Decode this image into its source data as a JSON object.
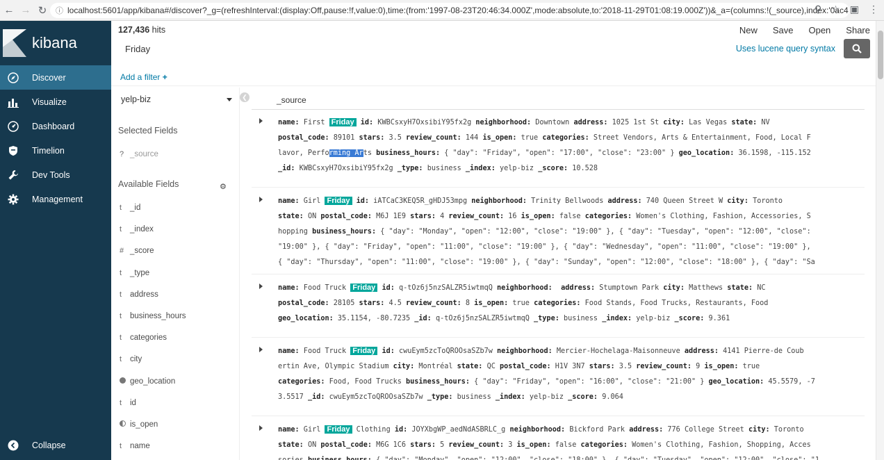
{
  "browser": {
    "url": "localhost:5601/app/kibana#/discover?_g=(refreshInterval:(display:Off,pause:!f,value:0),time:(from:'1997-08-23T20:46:34.000Z',mode:absolute,to:'2018-11-29T01:08:19.000Z'))&_a=(columns:!(_source),index:'0ac4..."
  },
  "sidebar": {
    "brand": "kibana",
    "items": [
      {
        "label": "Discover",
        "icon": "compass-icon"
      },
      {
        "label": "Visualize",
        "icon": "bar-chart-icon"
      },
      {
        "label": "Dashboard",
        "icon": "dashboard-icon"
      },
      {
        "label": "Timelion",
        "icon": "shield-icon"
      },
      {
        "label": "Dev Tools",
        "icon": "wrench-icon"
      },
      {
        "label": "Management",
        "icon": "gear-icon"
      }
    ],
    "collapse": "Collapse"
  },
  "header": {
    "hits_count": "127,436",
    "hits_label": "hits",
    "menu": [
      "New",
      "Save",
      "Open",
      "Share"
    ]
  },
  "query": {
    "text": "Friday",
    "syntax_link": "Uses lucene query syntax"
  },
  "filter": {
    "add_label": "Add a filter",
    "add_plus": "+"
  },
  "fields_panel": {
    "index": "yelp-biz",
    "selected_title": "Selected Fields",
    "selected": [
      {
        "type": "?",
        "name": "_source"
      }
    ],
    "available_title": "Available Fields",
    "available": [
      {
        "type": "t",
        "name": "_id"
      },
      {
        "type": "t",
        "name": "_index"
      },
      {
        "type": "#",
        "name": "_score"
      },
      {
        "type": "t",
        "name": "_type"
      },
      {
        "type": "t",
        "name": "address"
      },
      {
        "type": "t",
        "name": "business_hours"
      },
      {
        "type": "t",
        "name": "categories"
      },
      {
        "type": "t",
        "name": "city"
      },
      {
        "type": "geo",
        "name": "geo_location"
      },
      {
        "type": "t",
        "name": "id"
      },
      {
        "type": "bool",
        "name": "is_open"
      },
      {
        "type": "t",
        "name": "name"
      }
    ]
  },
  "docs": {
    "column": "_source",
    "highlight": "Friday",
    "rows": [
      {
        "lines": [
          [
            [
              "k",
              "name:"
            ],
            [
              "v",
              " First "
            ],
            [
              "h",
              "Friday"
            ],
            [
              "v",
              " "
            ],
            [
              "k",
              "id:"
            ],
            [
              "v",
              " KWBCsxyH7OxsibiY95fx2g "
            ],
            [
              "k",
              "neighborhood:"
            ],
            [
              "v",
              " Downtown "
            ],
            [
              "k",
              "address:"
            ],
            [
              "v",
              " 1025 1st St "
            ],
            [
              "k",
              "city:"
            ],
            [
              "v",
              " Las Vegas "
            ],
            [
              "k",
              "state:"
            ],
            [
              "v",
              " NV"
            ]
          ],
          [
            [
              "k",
              "postal_code:"
            ],
            [
              "v",
              " 89101 "
            ],
            [
              "k",
              "stars:"
            ],
            [
              "v",
              " 3.5 "
            ],
            [
              "k",
              "review_count:"
            ],
            [
              "v",
              " 144 "
            ],
            [
              "k",
              "is_open:"
            ],
            [
              "v",
              " true "
            ],
            [
              "k",
              "categories:"
            ],
            [
              "v",
              " Street Vendors, Arts & Entertainment, Food, Local F"
            ]
          ],
          [
            [
              "v",
              "lavor, Perfo"
            ],
            [
              "s",
              "rming Ar"
            ],
            [
              "v",
              "ts "
            ],
            [
              "k",
              "business_hours:"
            ],
            [
              "v",
              " { \"day\": \"Friday\", \"open\": \"17:00\", \"close\": \"23:00\" } "
            ],
            [
              "k",
              "geo_location:"
            ],
            [
              "v",
              " 36.1598, -115.152"
            ]
          ],
          [
            [
              "k",
              "_id:"
            ],
            [
              "v",
              " KWBCsxyH7OxsibiY95fx2g "
            ],
            [
              "k",
              "_type:"
            ],
            [
              "v",
              " business "
            ],
            [
              "k",
              "_index:"
            ],
            [
              "v",
              " yelp-biz "
            ],
            [
              "k",
              "_score:"
            ],
            [
              "v",
              " 10.528"
            ]
          ]
        ]
      },
      {
        "lines": [
          [
            [
              "k",
              "name:"
            ],
            [
              "v",
              " Girl "
            ],
            [
              "h",
              "Friday"
            ],
            [
              "v",
              " "
            ],
            [
              "k",
              "id:"
            ],
            [
              "v",
              " iATCaC3KEQ5R_gHDJ53mpg "
            ],
            [
              "k",
              "neighborhood:"
            ],
            [
              "v",
              " Trinity Bellwoods "
            ],
            [
              "k",
              "address:"
            ],
            [
              "v",
              " 740 Queen Street W "
            ],
            [
              "k",
              "city:"
            ],
            [
              "v",
              " Toronto"
            ]
          ],
          [
            [
              "k",
              "state:"
            ],
            [
              "v",
              " ON "
            ],
            [
              "k",
              "postal_code:"
            ],
            [
              "v",
              " M6J 1E9 "
            ],
            [
              "k",
              "stars:"
            ],
            [
              "v",
              " 4 "
            ],
            [
              "k",
              "review_count:"
            ],
            [
              "v",
              " 16 "
            ],
            [
              "k",
              "is_open:"
            ],
            [
              "v",
              " false "
            ],
            [
              "k",
              "categories:"
            ],
            [
              "v",
              " Women's Clothing, Fashion, Accessories, S"
            ]
          ],
          [
            [
              "v",
              "hopping "
            ],
            [
              "k",
              "business_hours:"
            ],
            [
              "v",
              " { \"day\": \"Monday\", \"open\": \"12:00\", \"close\": \"19:00\" }, { \"day\": \"Tuesday\", \"open\": \"12:00\", \"close\":"
            ]
          ],
          [
            [
              "v",
              "\"19:00\" }, { \"day\": \"Friday\", \"open\": \"11:00\", \"close\": \"19:00\" }, { \"day\": \"Wednesday\", \"open\": \"11:00\", \"close\": \"19:00\" },"
            ]
          ],
          [
            [
              "v",
              "{ \"day\": \"Thursday\", \"open\": \"11:00\", \"close\": \"19:00\" }, { \"day\": \"Sunday\", \"open\": \"12:00\", \"close\": \"18:00\" }, { \"day\": \"Sa"
            ]
          ]
        ]
      },
      {
        "lines": [
          [
            [
              "k",
              "name:"
            ],
            [
              "v",
              " Food Truck "
            ],
            [
              "h",
              "Friday"
            ],
            [
              "v",
              " "
            ],
            [
              "k",
              "id:"
            ],
            [
              "v",
              " q-tOz6j5nzSALZR5iwtmqQ "
            ],
            [
              "k",
              "neighborhood:"
            ],
            [
              "v",
              "  "
            ],
            [
              "k",
              "address:"
            ],
            [
              "v",
              " Stumptown Park "
            ],
            [
              "k",
              "city:"
            ],
            [
              "v",
              " Matthews "
            ],
            [
              "k",
              "state:"
            ],
            [
              "v",
              " NC"
            ]
          ],
          [
            [
              "k",
              "postal_code:"
            ],
            [
              "v",
              " 28105 "
            ],
            [
              "k",
              "stars:"
            ],
            [
              "v",
              " 4.5 "
            ],
            [
              "k",
              "review_count:"
            ],
            [
              "v",
              " 8 "
            ],
            [
              "k",
              "is_open:"
            ],
            [
              "v",
              " true "
            ],
            [
              "k",
              "categories:"
            ],
            [
              "v",
              " Food Stands, Food Trucks, Restaurants, Food"
            ]
          ],
          [
            [
              "k",
              "geo_location:"
            ],
            [
              "v",
              " 35.1154, -80.7235 "
            ],
            [
              "k",
              "_id:"
            ],
            [
              "v",
              " q-tOz6j5nzSALZR5iwtmqQ "
            ],
            [
              "k",
              "_type:"
            ],
            [
              "v",
              " business "
            ],
            [
              "k",
              "_index:"
            ],
            [
              "v",
              " yelp-biz "
            ],
            [
              "k",
              "_score:"
            ],
            [
              "v",
              " 9.361"
            ]
          ]
        ]
      },
      {
        "lines": [
          [
            [
              "k",
              "name:"
            ],
            [
              "v",
              " Food Truck "
            ],
            [
              "h",
              "Friday"
            ],
            [
              "v",
              " "
            ],
            [
              "k",
              "id:"
            ],
            [
              "v",
              " cwuEym5zcToQROOsaSZb7w "
            ],
            [
              "k",
              "neighborhood:"
            ],
            [
              "v",
              " Mercier-Hochelaga-Maisonneuve "
            ],
            [
              "k",
              "address:"
            ],
            [
              "v",
              " 4141 Pierre-de Coub"
            ]
          ],
          [
            [
              "v",
              "ertin Ave, Olympic Stadium "
            ],
            [
              "k",
              "city:"
            ],
            [
              "v",
              " Montréal "
            ],
            [
              "k",
              "state:"
            ],
            [
              "v",
              " QC "
            ],
            [
              "k",
              "postal_code:"
            ],
            [
              "v",
              " H1V 3N7 "
            ],
            [
              "k",
              "stars:"
            ],
            [
              "v",
              " 3.5 "
            ],
            [
              "k",
              "review_count:"
            ],
            [
              "v",
              " 9 "
            ],
            [
              "k",
              "is_open:"
            ],
            [
              "v",
              " true"
            ]
          ],
          [
            [
              "k",
              "categories:"
            ],
            [
              "v",
              " Food, Food Trucks "
            ],
            [
              "k",
              "business_hours:"
            ],
            [
              "v",
              " { \"day\": \"Friday\", \"open\": \"16:00\", \"close\": \"21:00\" } "
            ],
            [
              "k",
              "geo_location:"
            ],
            [
              "v",
              " 45.5579, -7"
            ]
          ],
          [
            [
              "v",
              "3.5517 "
            ],
            [
              "k",
              "_id:"
            ],
            [
              "v",
              " cwuEym5zcToQROOsaSZb7w "
            ],
            [
              "k",
              "_type:"
            ],
            [
              "v",
              " business "
            ],
            [
              "k",
              "_index:"
            ],
            [
              "v",
              " yelp-biz "
            ],
            [
              "k",
              "_score:"
            ],
            [
              "v",
              " 9.064"
            ]
          ]
        ]
      },
      {
        "lines": [
          [
            [
              "k",
              "name:"
            ],
            [
              "v",
              " Girl "
            ],
            [
              "h",
              "Friday"
            ],
            [
              "v",
              " Clothing "
            ],
            [
              "k",
              "id:"
            ],
            [
              "v",
              " JOYXbgWP_aedNdASBRLC_g "
            ],
            [
              "k",
              "neighborhood:"
            ],
            [
              "v",
              " Bickford Park "
            ],
            [
              "k",
              "address:"
            ],
            [
              "v",
              " 776 College Street "
            ],
            [
              "k",
              "city:"
            ],
            [
              "v",
              " Toronto"
            ]
          ],
          [
            [
              "k",
              "state:"
            ],
            [
              "v",
              " ON "
            ],
            [
              "k",
              "postal_code:"
            ],
            [
              "v",
              " M6G 1C6 "
            ],
            [
              "k",
              "stars:"
            ],
            [
              "v",
              " 5 "
            ],
            [
              "k",
              "review_count:"
            ],
            [
              "v",
              " 3 "
            ],
            [
              "k",
              "is_open:"
            ],
            [
              "v",
              " false "
            ],
            [
              "k",
              "categories:"
            ],
            [
              "v",
              " Women's Clothing, Fashion, Shopping, Acces"
            ]
          ],
          [
            [
              "v",
              "sories "
            ],
            [
              "k",
              "business_hours:"
            ],
            [
              "v",
              " { \"day\": \"Monday\", \"open\": \"12:00\", \"close\": \"18:00\" }, { \"day\": \"Tuesday\", \"open\": \"12:00\", \"close\": \"1"
            ]
          ]
        ]
      }
    ]
  }
}
